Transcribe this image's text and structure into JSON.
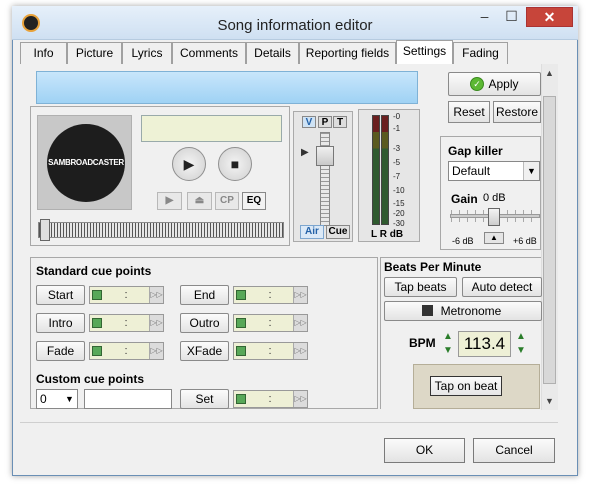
{
  "window": {
    "title": "Song information editor",
    "min_icon": "minimize-icon",
    "max_icon": "maximize-icon",
    "close_icon": "close-icon",
    "min_glyph": "‒",
    "max_glyph": "☐",
    "close_glyph": "✕"
  },
  "tabs": [
    {
      "label": "Info"
    },
    {
      "label": "Picture"
    },
    {
      "label": "Lyrics"
    },
    {
      "label": "Comments"
    },
    {
      "label": "Details"
    },
    {
      "label": "Reporting fields"
    },
    {
      "label": "Settings"
    },
    {
      "label": "Fading"
    }
  ],
  "active_tab": "Settings",
  "player": {
    "logo_text": "SAMBROADCASTER",
    "play_glyph": "▶",
    "stop_glyph": "■",
    "prev_glyph": "▶",
    "eject_glyph": "⏏",
    "cp_label": "CP",
    "eq_label": "EQ"
  },
  "vpt": {
    "v": "V",
    "p": "P",
    "t": "T",
    "air": "Air",
    "cue": "Cue",
    "arrow": "▶"
  },
  "meter": {
    "scale": [
      "-0",
      "-1",
      "-3",
      "-5",
      "-7",
      "-10",
      "-15",
      "-20",
      "-30"
    ],
    "label": "L R dB"
  },
  "actions": {
    "apply": "Apply",
    "apply_icon": "check-icon",
    "apply_glyph": "✓",
    "reset": "Reset",
    "restore": "Restore"
  },
  "gap_killer": {
    "title": "Gap killer",
    "selected": "Default",
    "arrow": "▼",
    "gain_label": "Gain",
    "gain_value": "0 dB",
    "min": "-6 dB",
    "max": "+6 dB",
    "reset_glyph": "▲"
  },
  "cue_points": {
    "standard_title": "Standard cue points",
    "custom_title": "Custom cue points",
    "time_text": ":",
    "go_glyph": "▷▷",
    "buttons": [
      "Start",
      "End",
      "Intro",
      "Outro",
      "Fade",
      "XFade"
    ],
    "custom_selected": "0",
    "custom_arrow": "▼",
    "set": "Set"
  },
  "bpm": {
    "title": "Beats Per Minute",
    "tap_beats": "Tap beats",
    "auto_detect": "Auto detect",
    "metronome": "Metronome",
    "label": "BPM",
    "value": "113.4",
    "up": "▲",
    "down": "▼",
    "tap_on_beat": "Tap on beat"
  },
  "scroll": {
    "up": "▲",
    "down": "▼"
  },
  "dialog": {
    "ok": "OK",
    "cancel": "Cancel"
  }
}
